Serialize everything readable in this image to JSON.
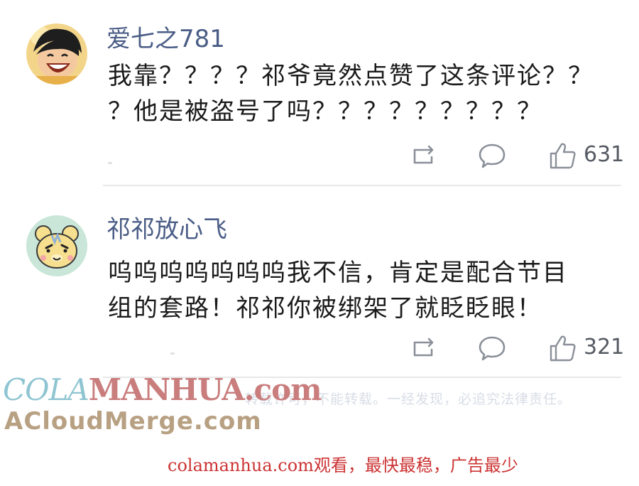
{
  "comments": [
    {
      "username": "爱七之781",
      "text_line1": "我靠？？？？祁爷竟然点赞了这条评论？？",
      "text_line2": "？他是被盗号了吗？？？？？？？？？",
      "like_count": "631",
      "avatar_icon": "anime-boy-avatar-icon"
    },
    {
      "username": "祁祁放心飞",
      "text_line1": "呜呜呜呜呜呜呜我不信，肯定是配合节目",
      "text_line2": "组的套路！祁祁你被绑架了就眨眨眼！",
      "like_count": "321",
      "avatar_icon": "bear-avatar-icon"
    }
  ],
  "actions": {
    "repost_icon": "repost-icon",
    "comment_icon": "comment-bubble-icon",
    "like_icon": "thumbs-up-icon"
  },
  "notice": "转载许可，不能转载。一经发现，必追究法律责任。",
  "watermarks": {
    "colamanhua_part1": "COLA",
    "colamanhua_part2": "MANHUA.com",
    "acloudmerge": "ACloudMerge.com"
  },
  "footer_text": "colamanhua.com观看，最快最稳，广告最少",
  "colors": {
    "username": "#4a5d86",
    "text": "#1a1a1a",
    "icon": "#8a8f99",
    "footer": "#cc3333",
    "divider": "#e8e8e8"
  }
}
